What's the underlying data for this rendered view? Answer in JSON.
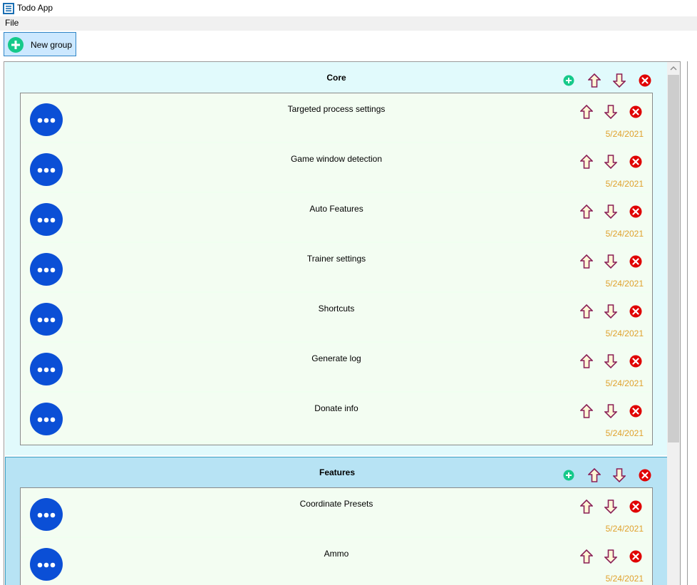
{
  "window": {
    "title": "Todo App"
  },
  "menu": {
    "file": "File"
  },
  "toolbar": {
    "new_group_label": "New group"
  },
  "colors": {
    "accent_green": "#16c98a",
    "avatar_blue": "#0b4fd6",
    "delete_red": "#e00000",
    "date_orange": "#e0a12c",
    "arrow_brown": "#8a1f56"
  },
  "groups": [
    {
      "title": "Core",
      "items": [
        {
          "title": "Targeted process settings",
          "date": "5/24/2021"
        },
        {
          "title": "Game window detection",
          "date": "5/24/2021"
        },
        {
          "title": "Auto Features",
          "date": "5/24/2021"
        },
        {
          "title": "Trainer settings",
          "date": "5/24/2021"
        },
        {
          "title": "Shortcuts",
          "date": "5/24/2021"
        },
        {
          "title": "Generate log",
          "date": "5/24/2021"
        },
        {
          "title": "Donate info",
          "date": "5/24/2021"
        }
      ]
    },
    {
      "title": "Features",
      "items": [
        {
          "title": "Coordinate Presets",
          "date": "5/24/2021"
        },
        {
          "title": "Ammo",
          "date": "5/24/2021"
        }
      ]
    }
  ]
}
